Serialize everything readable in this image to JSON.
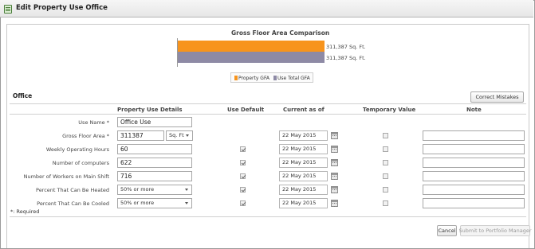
{
  "window": {
    "title": "Edit Property Use Office"
  },
  "chart_data": {
    "type": "bar",
    "title": "Gross Floor Area Comparison",
    "orientation": "horizontal",
    "series": [
      {
        "name": "Property GFA",
        "value": 311387,
        "label": "311,387 Sq. Ft.",
        "color": "#f7941d"
      },
      {
        "name": "Use Total GFA",
        "value": 311387,
        "label": "311,387 Sq. Ft.",
        "color": "#8e8aa5"
      }
    ],
    "legend": [
      "Property GFA",
      "Use Total GFA"
    ]
  },
  "section": {
    "title": "Office"
  },
  "buttons": {
    "correct": "Correct Mistakes",
    "cancel": "Cancel",
    "submit": "Submit to Portfolio Manager"
  },
  "columns": {
    "details": "Property Use Details",
    "use_default": "Use Default",
    "current_as_of": "Current as of",
    "temporary": "Temporary Value",
    "note": "Note"
  },
  "rows": [
    {
      "label": "Use Name *",
      "value": "Office Use",
      "kind": "input",
      "use_default": null,
      "date": null,
      "temporary": null
    },
    {
      "label": "Gross Floor Area *",
      "value": "311387",
      "unit": "Sq. Ft",
      "kind": "input-unit",
      "use_default": null,
      "date": "22 May 2015",
      "temporary": false
    },
    {
      "label": "Weekly Operating Hours",
      "value": "60",
      "kind": "input",
      "use_default": true,
      "date": "22 May 2015",
      "temporary": false
    },
    {
      "label": "Number of computers",
      "value": "622",
      "kind": "input",
      "use_default": true,
      "date": "22 May 2015",
      "temporary": false
    },
    {
      "label": "Number of Workers on Main Shift",
      "value": "716",
      "kind": "input",
      "use_default": true,
      "date": "22 May 2015",
      "temporary": false
    },
    {
      "label": "Percent That Can Be Heated",
      "value": "50% or more",
      "kind": "select",
      "use_default": true,
      "date": "22 May 2015",
      "temporary": false
    },
    {
      "label": "Percent That Can Be Cooled",
      "value": "50% or more",
      "kind": "select",
      "use_default": true,
      "date": "22 May 2015",
      "temporary": false
    }
  ],
  "footer": {
    "required_note": "*: Required"
  }
}
